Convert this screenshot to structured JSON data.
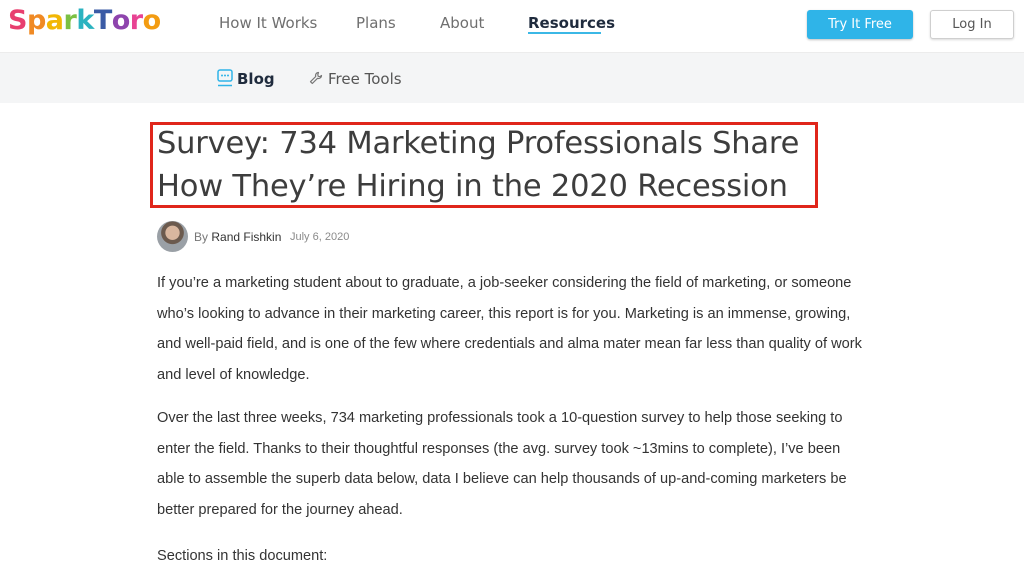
{
  "header": {
    "logo_letters": [
      "S",
      "p",
      "a",
      "r",
      "k",
      "T",
      "o",
      "r",
      "o"
    ],
    "logo_colors": [
      "#e83f6f",
      "#f08a24",
      "#f2b705",
      "#7bc043",
      "#2bb3c0",
      "#3b5ba5",
      "#8e44ad",
      "#e84393",
      "#f39c12"
    ],
    "nav": [
      {
        "label": "How It Works"
      },
      {
        "label": "Plans"
      },
      {
        "label": "About"
      },
      {
        "label": "Resources"
      }
    ],
    "try_label": "Try It Free",
    "login_label": "Log In"
  },
  "subnav": {
    "blog_label": "Blog",
    "tools_label": "Free Tools",
    "blog_icon": "chat-bubble-icon",
    "tools_icon": "wrench-icon"
  },
  "article": {
    "title": "Survey: 734 Marketing Professionals Share How They’re Hiring in the 2020 Recession",
    "by": "By",
    "author": "Rand Fishkin",
    "date": "July 6, 2020",
    "paragraphs": [
      "If you’re a marketing student about to graduate, a job-seeker considering the field of marketing, or someone who’s looking to advance in their marketing career, this report is for you. Marketing is an immense, growing, and well-paid field, and is one of the few where credentials and alma mater mean far less than quality of work and level of knowledge.",
      "Over the last three weeks, 734 marketing professionals took a 10-question survey to help those seeking to enter the field. Thanks to their thoughtful responses (the avg. survey took ~13mins to complete), I’ve been able to assemble the superb data below, data I believe can help thousands of up-and-coming marketers be better prepared for the journey ahead.",
      "Sections in this document:"
    ]
  },
  "colors": {
    "accent": "#2fb4e8",
    "highlight_box": "#e0261b"
  }
}
